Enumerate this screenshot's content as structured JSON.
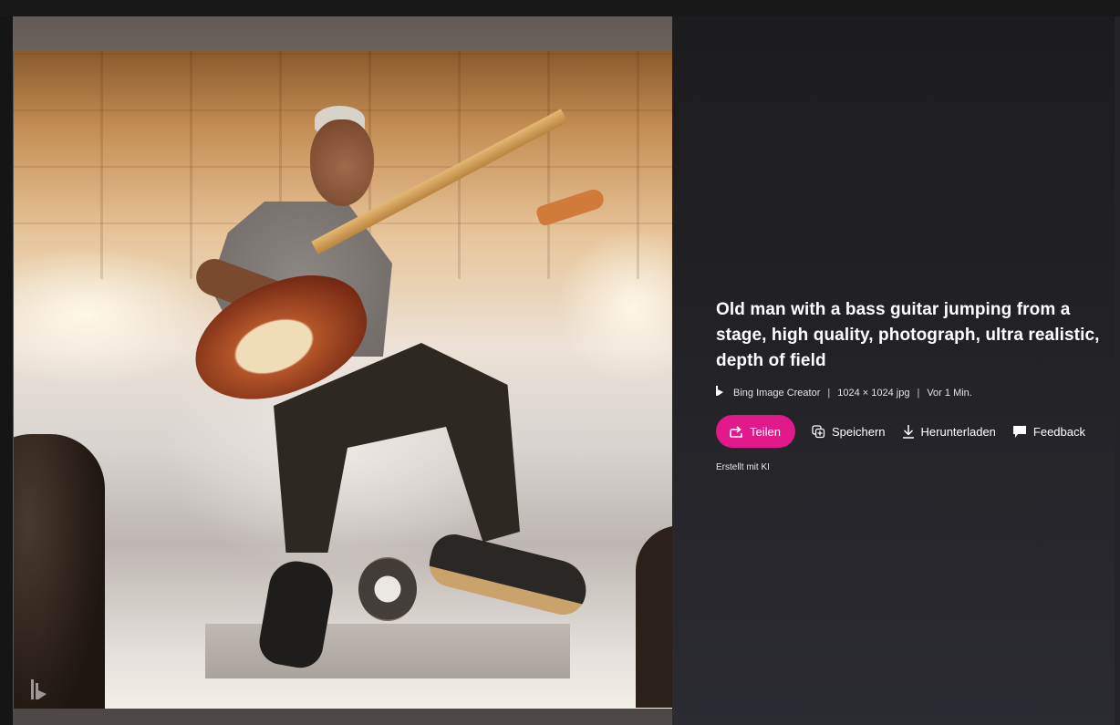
{
  "image": {
    "alt": "Old man with a bass guitar jumping from a stage",
    "watermark_icon": "bing-logo-icon"
  },
  "details": {
    "prompt": "Old man with a bass guitar jumping from a stage, high quality, photograph, ultra realistic, depth of field",
    "meta": {
      "source_icon": "bing-logo-icon",
      "source": "Bing Image Creator",
      "separator": "|",
      "dimensions": "1024 × 1024 jpg",
      "age": "Vor 1 Min."
    },
    "actions": {
      "share_label": "Teilen",
      "share_icon": "share-arrow-icon",
      "save_label": "Speichern",
      "save_icon": "collection-add-icon",
      "download_label": "Herunterladen",
      "download_icon": "download-icon",
      "feedback_label": "Feedback",
      "feedback_icon": "speech-bubble-icon"
    },
    "ai_note": "Erstellt mit KI"
  },
  "colors": {
    "accent": "#e2198a",
    "panel_background": "#1c1c1e",
    "text": "#ffffff"
  }
}
